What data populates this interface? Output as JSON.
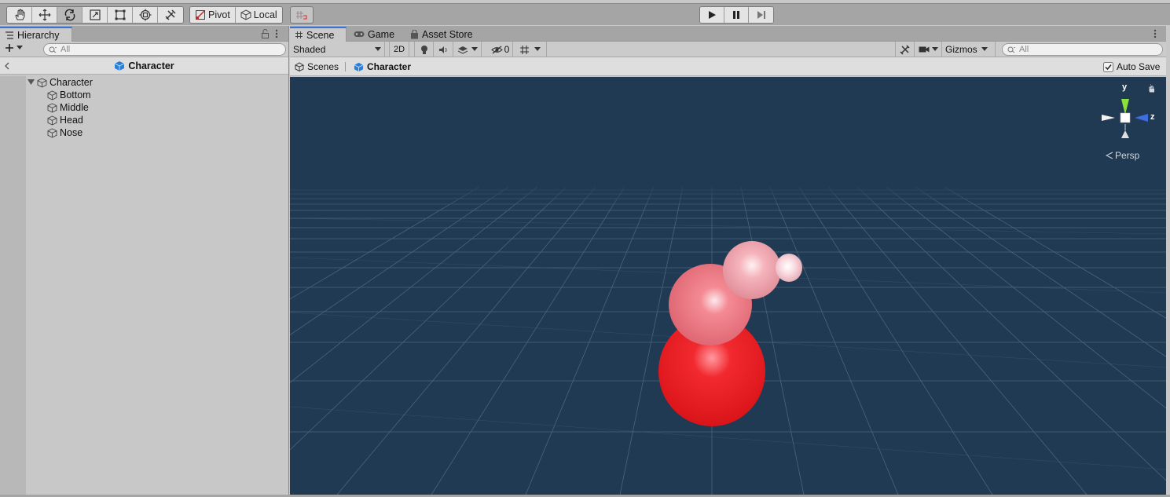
{
  "toolbar": {
    "tools": [
      "hand-tool-icon",
      "move-tool-icon",
      "rotate-tool-icon",
      "scale-tool-icon",
      "rect-tool-icon",
      "transform-tool-icon",
      "custom-tool-icon"
    ],
    "pivot_label": "Pivot",
    "local_label": "Local"
  },
  "hierarchy": {
    "tab_label": "Hierarchy",
    "search_placeholder": "All",
    "breadcrumb_title": "Character",
    "root": "Character",
    "children": [
      "Bottom",
      "Middle",
      "Head",
      "Nose"
    ]
  },
  "scene": {
    "tabs": [
      "Scene",
      "Game",
      "Asset Store"
    ],
    "draw_mode": "Shaded",
    "mode_2d": "2D",
    "hidden_count": "0",
    "gizmos_label": "Gizmos",
    "search_placeholder": "All",
    "breadcrumb_root": "Scenes",
    "breadcrumb_current": "Character",
    "auto_save_label": "Auto Save",
    "auto_save_checked": true,
    "gizmo_y": "y",
    "gizmo_z": "z",
    "projection_label": "Persp"
  },
  "colors": {
    "viewport_bg": "#203a54",
    "grid": "#4f667c",
    "bottom_sphere": "#ee1e22",
    "middle_sphere": "#f07a82",
    "head_sphere": "#f4aab2",
    "nose_sphere": "#f7d4da",
    "accent": "#3a72d8"
  }
}
